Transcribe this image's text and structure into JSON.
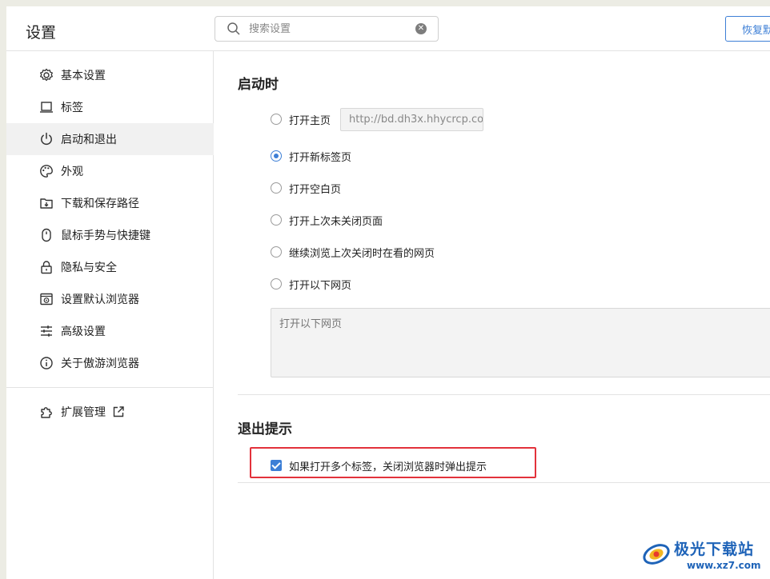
{
  "header": {
    "title": "设置",
    "search_placeholder": "搜索设置",
    "restore_label": "恢复默认设置"
  },
  "sidebar": {
    "items": [
      {
        "label": "基本设置",
        "icon": "gear-icon",
        "active": false
      },
      {
        "label": "标签",
        "icon": "tab-icon",
        "active": false
      },
      {
        "label": "启动和退出",
        "icon": "power-icon",
        "active": true
      },
      {
        "label": "外观",
        "icon": "palette-icon",
        "active": false
      },
      {
        "label": "下载和保存路径",
        "icon": "download-folder-icon",
        "active": false
      },
      {
        "label": "鼠标手势与快捷键",
        "icon": "mouse-icon",
        "active": false
      },
      {
        "label": "隐私与安全",
        "icon": "lock-icon",
        "active": false
      },
      {
        "label": "设置默认浏览器",
        "icon": "browser-icon",
        "active": false
      },
      {
        "label": "高级设置",
        "icon": "sliders-icon",
        "active": false
      },
      {
        "label": "关于傲游浏览器",
        "icon": "info-icon",
        "active": false
      }
    ],
    "extensions": {
      "label": "扩展管理",
      "icon": "puzzle-icon",
      "trailing_icon": "external-link-icon"
    }
  },
  "startup": {
    "title": "启动时",
    "options": [
      {
        "label": "打开主页",
        "checked": false
      },
      {
        "label": "打开新标签页",
        "checked": true
      },
      {
        "label": "打开空白页",
        "checked": false
      },
      {
        "label": "打开上次未关闭页面",
        "checked": false
      },
      {
        "label": "继续浏览上次关闭时在看的网页",
        "checked": false
      },
      {
        "label": "打开以下网页",
        "checked": false
      }
    ],
    "homepage_value": "http://bd.dh3x.hhycrcp.co",
    "pages_placeholder": "打开以下网页"
  },
  "exit": {
    "title": "退出提示",
    "checkbox_label": "如果打开多个标签，关闭浏览器时弹出提示",
    "checked": true
  },
  "watermark": {
    "title": "极光下载站",
    "url": "www.xz7.com"
  },
  "colors": {
    "accent": "#3d7fd6",
    "highlight": "#e3323b",
    "active_bg": "#f1f1f1"
  }
}
